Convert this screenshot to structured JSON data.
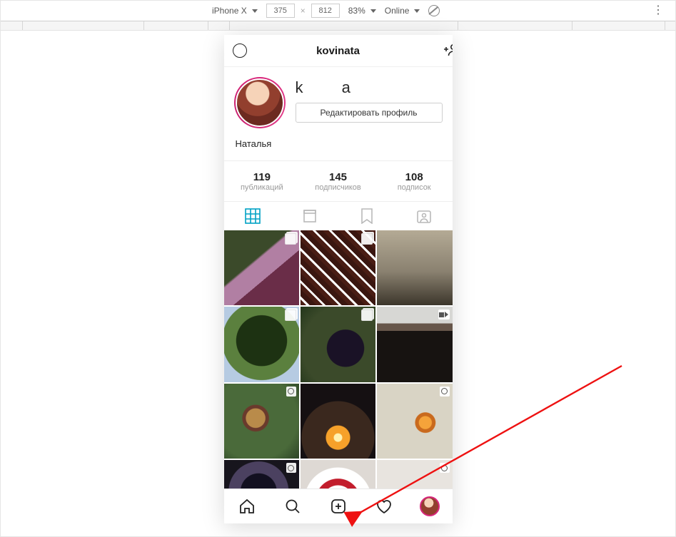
{
  "devtools": {
    "device": "iPhone X",
    "width": "375",
    "height": "812",
    "zoom": "83%",
    "network": "Online"
  },
  "header": {
    "username": "kovinata"
  },
  "profile": {
    "handle_display": "k   a",
    "edit_label": "Редактировать профиль",
    "display_name": "Наталья"
  },
  "stats": {
    "posts": {
      "count": "119",
      "label": "публикаций"
    },
    "followers": {
      "count": "145",
      "label": "подписчиков"
    },
    "following": {
      "count": "108",
      "label": "подписок"
    }
  }
}
